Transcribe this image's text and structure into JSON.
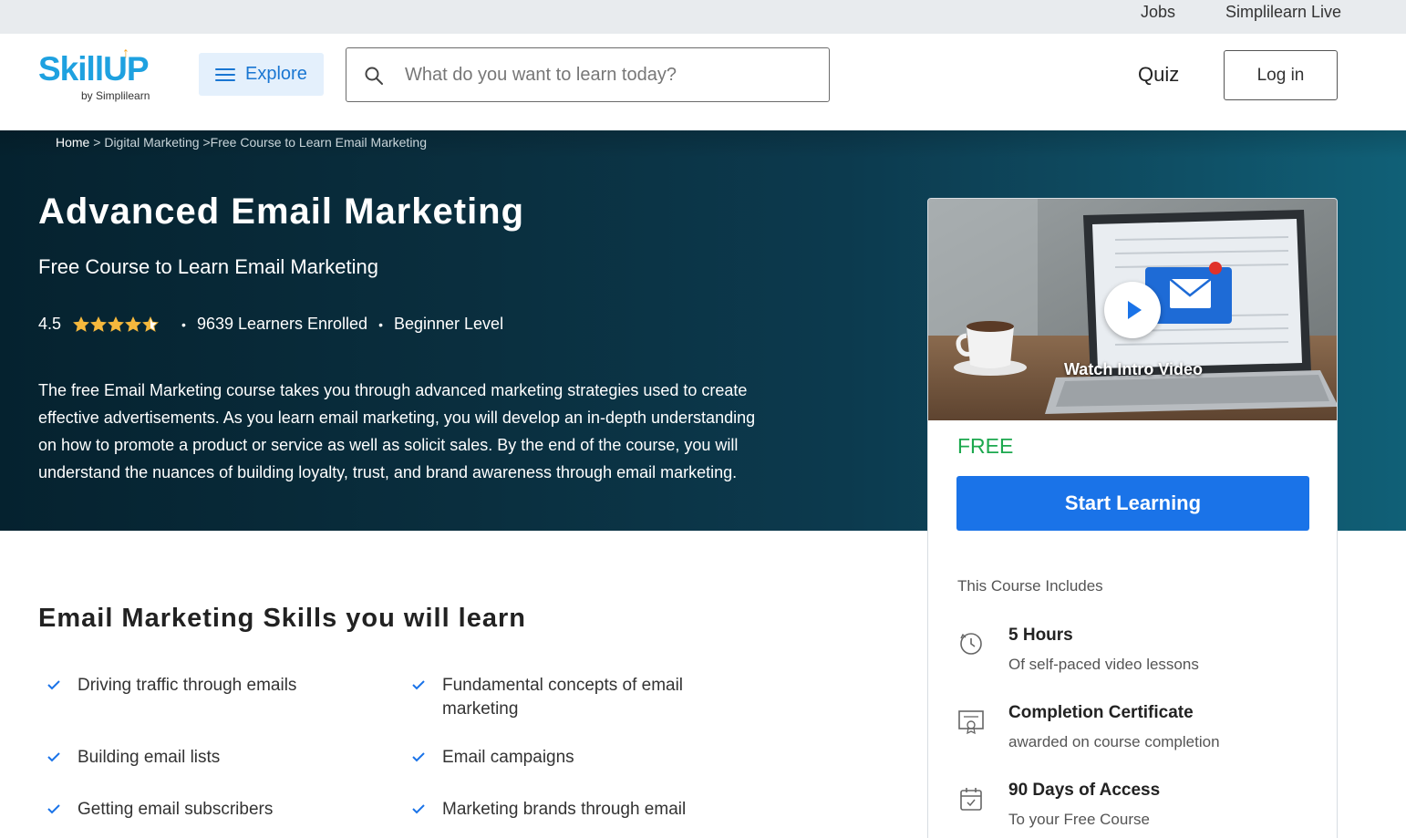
{
  "topbar": {
    "jobs": "Jobs",
    "live": "Simplilearn Live"
  },
  "header": {
    "logo_main": "SkillUP",
    "logo_sub": "by Simplilearn",
    "explore_label": "Explore",
    "search_placeholder": "What do you want to learn today?",
    "quiz_label": "Quiz",
    "login_label": "Log in"
  },
  "breadcrumb": {
    "home": "Home",
    "sep1": " > ",
    "category": "Digital Marketing",
    "sep2": " >",
    "current": "Free Course to Learn Email Marketing"
  },
  "course": {
    "title": "Advanced Email Marketing",
    "subtitle": "Free Course to Learn Email Marketing",
    "rating": "4.5",
    "rating_value": 4.5,
    "learners": "9639 Learners Enrolled",
    "level": "Beginner Level",
    "description": "The free Email Marketing course takes you through advanced marketing strategies used to create effective advertisements. As you learn email marketing, you will develop an in-depth understanding on how to promote a product or service as well as solicit sales. By the end of the course, you will understand the nuances of building loyalty, trust, and brand awareness through email marketing."
  },
  "card": {
    "video_label": "Watch Intro Video",
    "price": "FREE",
    "cta": "Start Learning",
    "includes_title": "This Course Includes",
    "includes": [
      {
        "icon": "clock-icon",
        "title": "5 Hours",
        "sub": "Of self-paced video lessons"
      },
      {
        "icon": "certificate-icon",
        "title": "Completion Certificate",
        "sub": "awarded on course completion"
      },
      {
        "icon": "calendar-icon",
        "title": "90 Days of Access",
        "sub": "To your Free Course"
      }
    ]
  },
  "skills": {
    "title": "Email Marketing Skills you will learn",
    "items": [
      "Driving traffic through emails",
      "Fundamental concepts of email marketing",
      "Building email lists",
      "Email campaigns",
      "Getting email subscribers",
      "Marketing brands through email"
    ]
  },
  "colors": {
    "accent": "#1a73e8",
    "free": "#1ca84e",
    "hero_bg": "#0a2f3f",
    "star": "#f5b83d"
  }
}
